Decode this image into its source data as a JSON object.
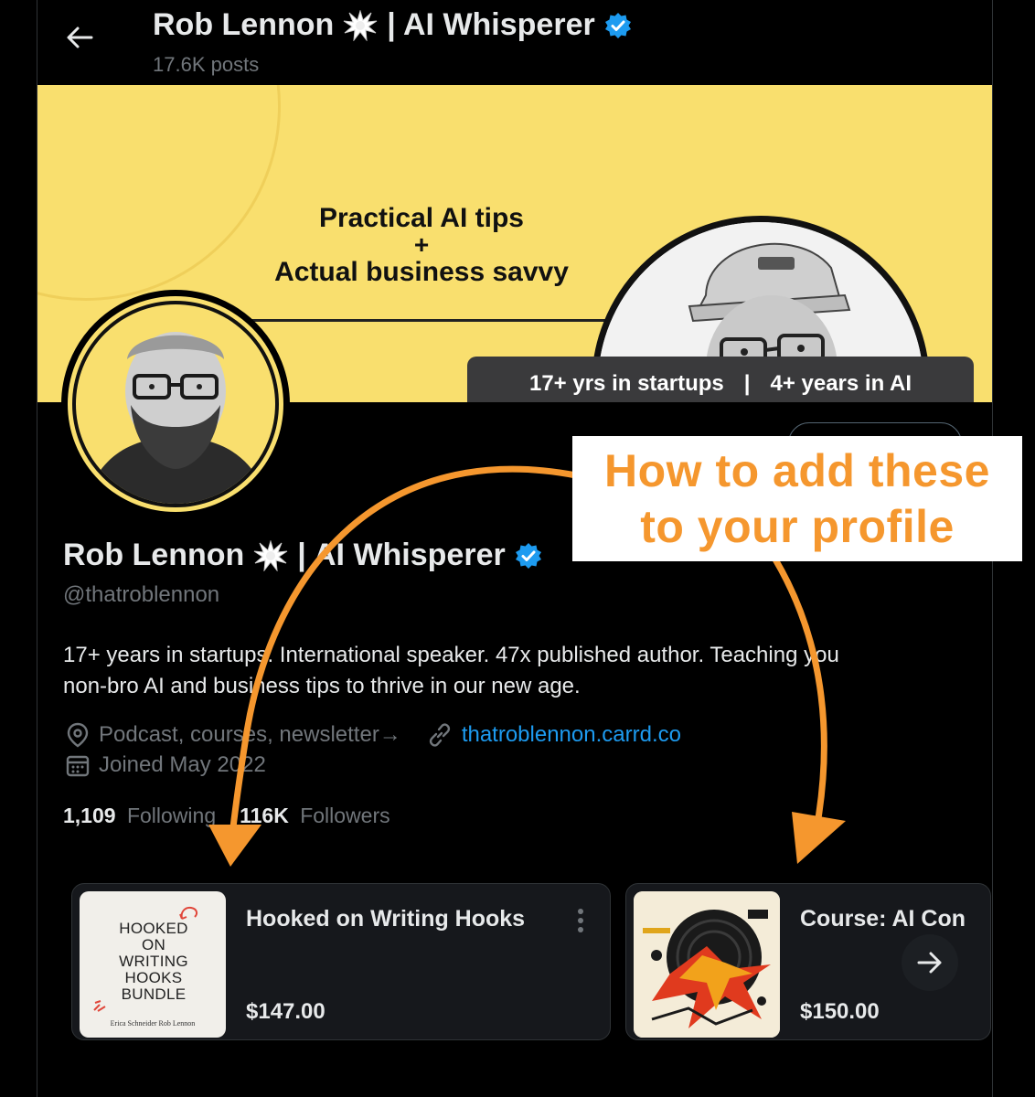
{
  "header": {
    "title": "Rob Lennon 💥 | AI Whisperer",
    "name": "Rob Lennon",
    "name_suffix": "| AI Whisperer",
    "posts_count": "17.6K posts"
  },
  "banner": {
    "headline_1": "Practical AI tips",
    "headline_plus": "+",
    "headline_2": "Actual business savvy",
    "stat_1": "17+ yrs in startups",
    "stat_sep": "|",
    "stat_2": "4+ years in AI"
  },
  "profile": {
    "name": "Rob Lennon",
    "name_suffix": "| AI Whisperer",
    "handle": "@thatroblennon",
    "bio_line_1": "17+ years in startups. International speaker. 47x published author. Teaching you",
    "bio_line_2": "non-bro AI and business tips to thrive in our new age.",
    "location": "Podcast, courses, newsletter→",
    "website": "thatroblennon.carrd.co",
    "joined": "Joined May 2022",
    "following_count": "1,109",
    "following_label": "Following",
    "followers_count": "116K",
    "followers_label": "Followers"
  },
  "products": [
    {
      "title": "Hooked on Writing Hooks",
      "price": "$147.00",
      "cover_lines": [
        "HOOKED",
        "ON",
        "WRITING",
        "HOOKS",
        "BUNDLE"
      ],
      "cover_authors": "Erica Schneider   Rob Lennon"
    },
    {
      "title": "Course: AI Con",
      "price": "$150.00"
    }
  ],
  "annotation": {
    "line_1": "How to add these",
    "line_2": "to your profile",
    "color": "#f5972e"
  },
  "colors": {
    "background": "#000000",
    "banner_yellow": "#f9df6e",
    "link_blue": "#1d9bf0",
    "verified_blue": "#1d9bf0",
    "muted_text": "#71767b"
  },
  "icons": [
    "back-arrow-icon",
    "verified-badge-icon",
    "burst-emoji-icon",
    "location-icon",
    "link-icon",
    "calendar-icon",
    "more-icon",
    "arrow-right-icon"
  ]
}
